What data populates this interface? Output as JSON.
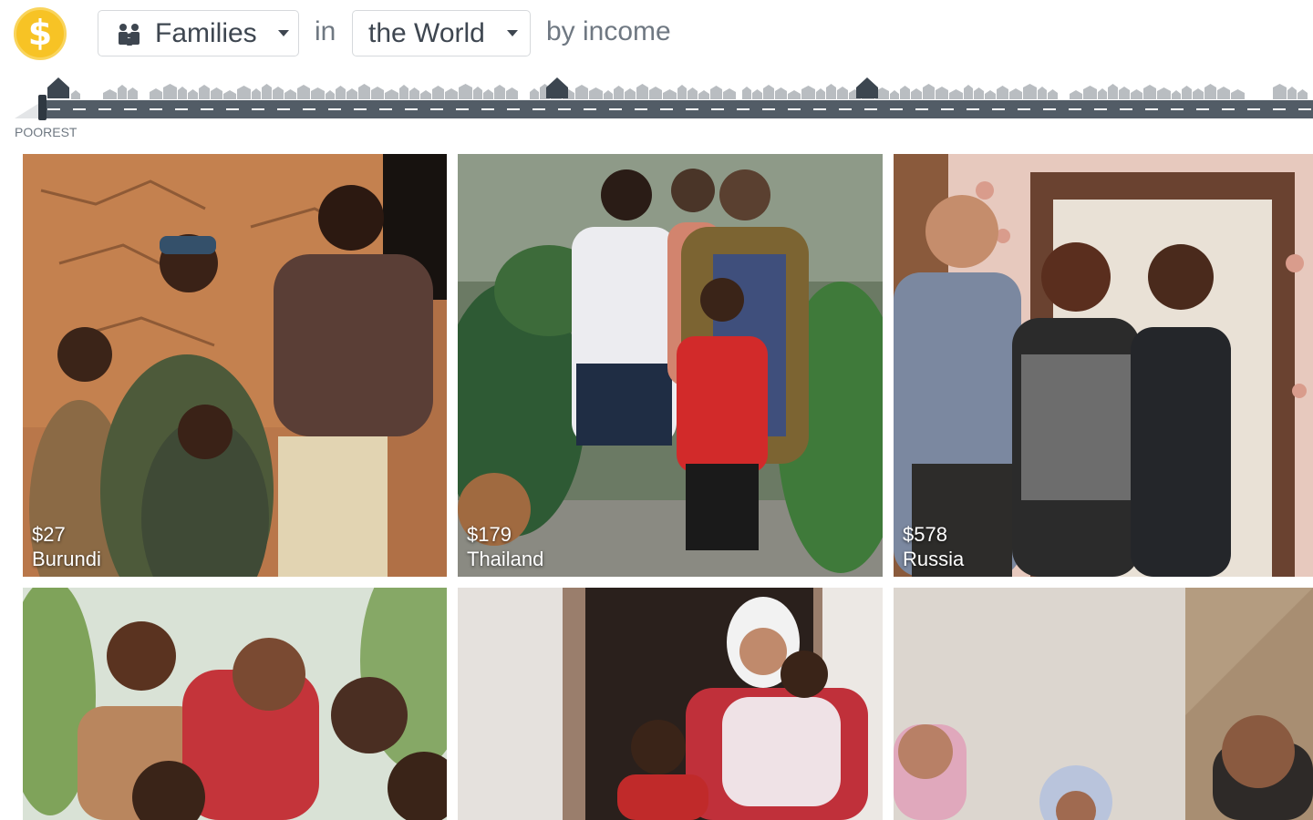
{
  "header": {
    "logo_icon": "dollar-coin-icon",
    "logo_glyph": "$",
    "type_select": {
      "icon": "family-icon",
      "selected": "Families"
    },
    "connector_in": "in",
    "region_select": {
      "selected": "the World"
    },
    "sort_text": "by income"
  },
  "street": {
    "left_label": "POOREST"
  },
  "gallery": {
    "cards": [
      {
        "income": "$27",
        "country": "Burundi"
      },
      {
        "income": "$179",
        "country": "Thailand"
      },
      {
        "income": "$578",
        "country": "Russia"
      },
      {
        "income": "",
        "country": ""
      },
      {
        "income": "",
        "country": ""
      },
      {
        "income": "",
        "country": ""
      }
    ]
  },
  "colors": {
    "accent": "#f7c325",
    "road": "#525c66",
    "house": "#b9bdc1",
    "house_active": "#3c4650"
  }
}
